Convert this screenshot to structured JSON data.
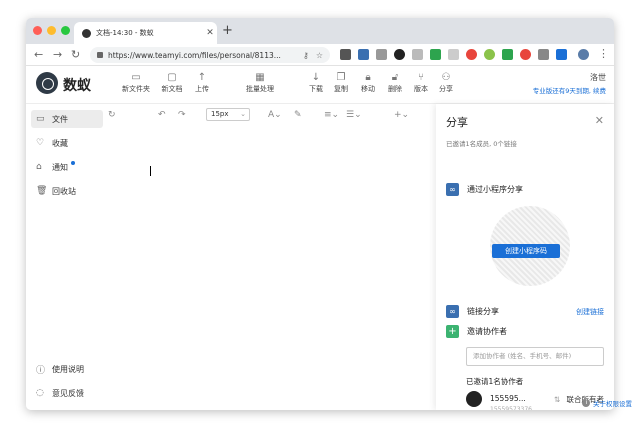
{
  "browser": {
    "tab_title": "文档-14:30 - 数蚁",
    "url": "https://www.teamyi.com/files/personal/8113..."
  },
  "app": {
    "brand": "数蚁",
    "toolbar": [
      "新文件夹",
      "新文档",
      "上传",
      "批量处理",
      "下载",
      "复制",
      "移动",
      "删除",
      "版本",
      "分享"
    ],
    "user": "洛世",
    "promo": "专业版还有9天到期, 续费"
  },
  "sidebar": {
    "items": [
      "文件",
      "收藏",
      "通知",
      "回收站"
    ],
    "bottom": [
      "使用说明",
      "意见反馈"
    ]
  },
  "editor": {
    "font_size": "15px"
  },
  "share": {
    "title": "分享",
    "subtitle": "已邀请1名成员, 0个链接",
    "miniprogram": "通过小程序分享",
    "qr_button": "创建小程序码",
    "link_share": "链接分享",
    "create_link": "创建链接",
    "invite": "邀请协作者",
    "invite_placeholder": "添加协作者 (姓名、手机号、邮件)",
    "invited_title": "已邀请1名协作者",
    "collaborator_name": "155595...",
    "collaborator_sub": "15559573376",
    "collaborator_role": "联合所有者",
    "permission_link": "关于权限设置"
  },
  "colors": {
    "accent": "#1a6fd6",
    "green": "#3cb371"
  }
}
